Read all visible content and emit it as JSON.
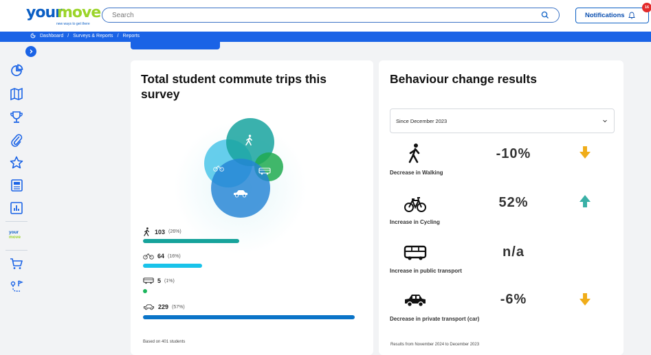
{
  "brand": {
    "word1": "your",
    "word2": "move",
    "tagline": "new ways to get there"
  },
  "search": {
    "placeholder": "Search",
    "icon": "search-icon"
  },
  "notifications": {
    "label": "Notifications",
    "count": "16",
    "icon": "bell-icon"
  },
  "breadcrumb": {
    "items": [
      "Dashboard",
      "Surveys & Reports",
      "Reports"
    ],
    "separator": "/"
  },
  "sidebar": {
    "icons": [
      "pie-chart-icon",
      "map-icon",
      "trophy-icon",
      "paperclip-icon",
      "star-icon",
      "newspaper-icon",
      "bar-chart-icon",
      "cart-icon",
      "route-icon"
    ],
    "mini_logo": {
      "word1": "your",
      "word2": "move"
    }
  },
  "trips_card": {
    "title": "Total student commute trips this survey",
    "modes": [
      {
        "mode": "walking",
        "icon": "walking-icon",
        "count": "103",
        "percent": "(26%)",
        "share": 0.26,
        "color": "#16a39b"
      },
      {
        "mode": "cycling",
        "icon": "bicycle-icon",
        "count": "64",
        "percent": "(16%)",
        "share": 0.16,
        "color": "#19c3ea"
      },
      {
        "mode": "public transport",
        "icon": "bus-icon",
        "count": "5",
        "percent": "(1%)",
        "share": 0.01,
        "color": "#1bb55c"
      },
      {
        "mode": "car",
        "icon": "car-icon",
        "count": "229",
        "percent": "(57%)",
        "share": 0.57,
        "color": "#0a74c8"
      }
    ],
    "footnote": "Based on 401 students"
  },
  "behaviour_card": {
    "title": "Behaviour change results",
    "period_select": "Since December 2023",
    "results": [
      {
        "icon": "walking-icon",
        "value": "-10%",
        "label": "Decrease in Walking",
        "trend": "down",
        "trend_color": "#f0ad1a"
      },
      {
        "icon": "bicycle-icon",
        "value": "52%",
        "label": "Increase in Cycling",
        "trend": "up",
        "trend_color": "#3ab0a6"
      },
      {
        "icon": "bus-icon",
        "value": "n/a",
        "label": "Increase in public transport",
        "trend": "none",
        "trend_color": ""
      },
      {
        "icon": "car-icon",
        "value": "-6%",
        "label": "Decrease in private transport (car)",
        "trend": "down",
        "trend_color": "#f0ad1a"
      }
    ],
    "footnote": "Results from November 2024 to December 2023"
  },
  "colors": {
    "primary": "#1a63e6",
    "brand_blue": "#0a5ec4",
    "brand_green": "#9bd42a",
    "badge_red": "#e32b2b"
  }
}
